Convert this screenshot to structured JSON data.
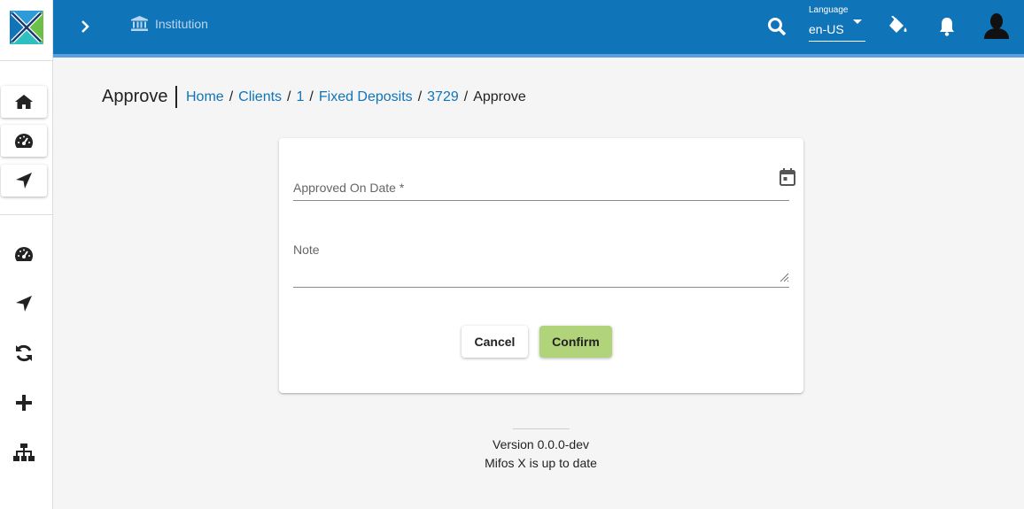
{
  "header": {
    "institution_label": "Institution",
    "language_label": "Language",
    "language_value": "en-US"
  },
  "page": {
    "title": "Approve",
    "breadcrumb": [
      {
        "label": "Home",
        "link": true
      },
      {
        "label": "Clients",
        "link": true
      },
      {
        "label": "1",
        "link": true
      },
      {
        "label": "Fixed Deposits",
        "link": true
      },
      {
        "label": "3729",
        "link": true
      },
      {
        "label": "Approve",
        "link": false
      }
    ]
  },
  "form": {
    "approved_on_date_label": "Approved On Date *",
    "approved_on_date_value": "",
    "note_label": "Note",
    "note_value": "",
    "cancel_label": "Cancel",
    "confirm_label": "Confirm"
  },
  "footer": {
    "version": "Version 0.0.0-dev",
    "status": "Mifos X is up to date"
  },
  "colors": {
    "toolbar": "#1074b9",
    "link": "#1074b9",
    "confirm_button": "#b1d47a"
  },
  "icons": {
    "sidebar_top": [
      "home-icon",
      "dashboard-icon",
      "navigation-icon"
    ],
    "sidebar_bottom": [
      "dashboard-icon",
      "navigation-icon",
      "sync-icon",
      "plus-icon",
      "sitemap-icon"
    ]
  }
}
